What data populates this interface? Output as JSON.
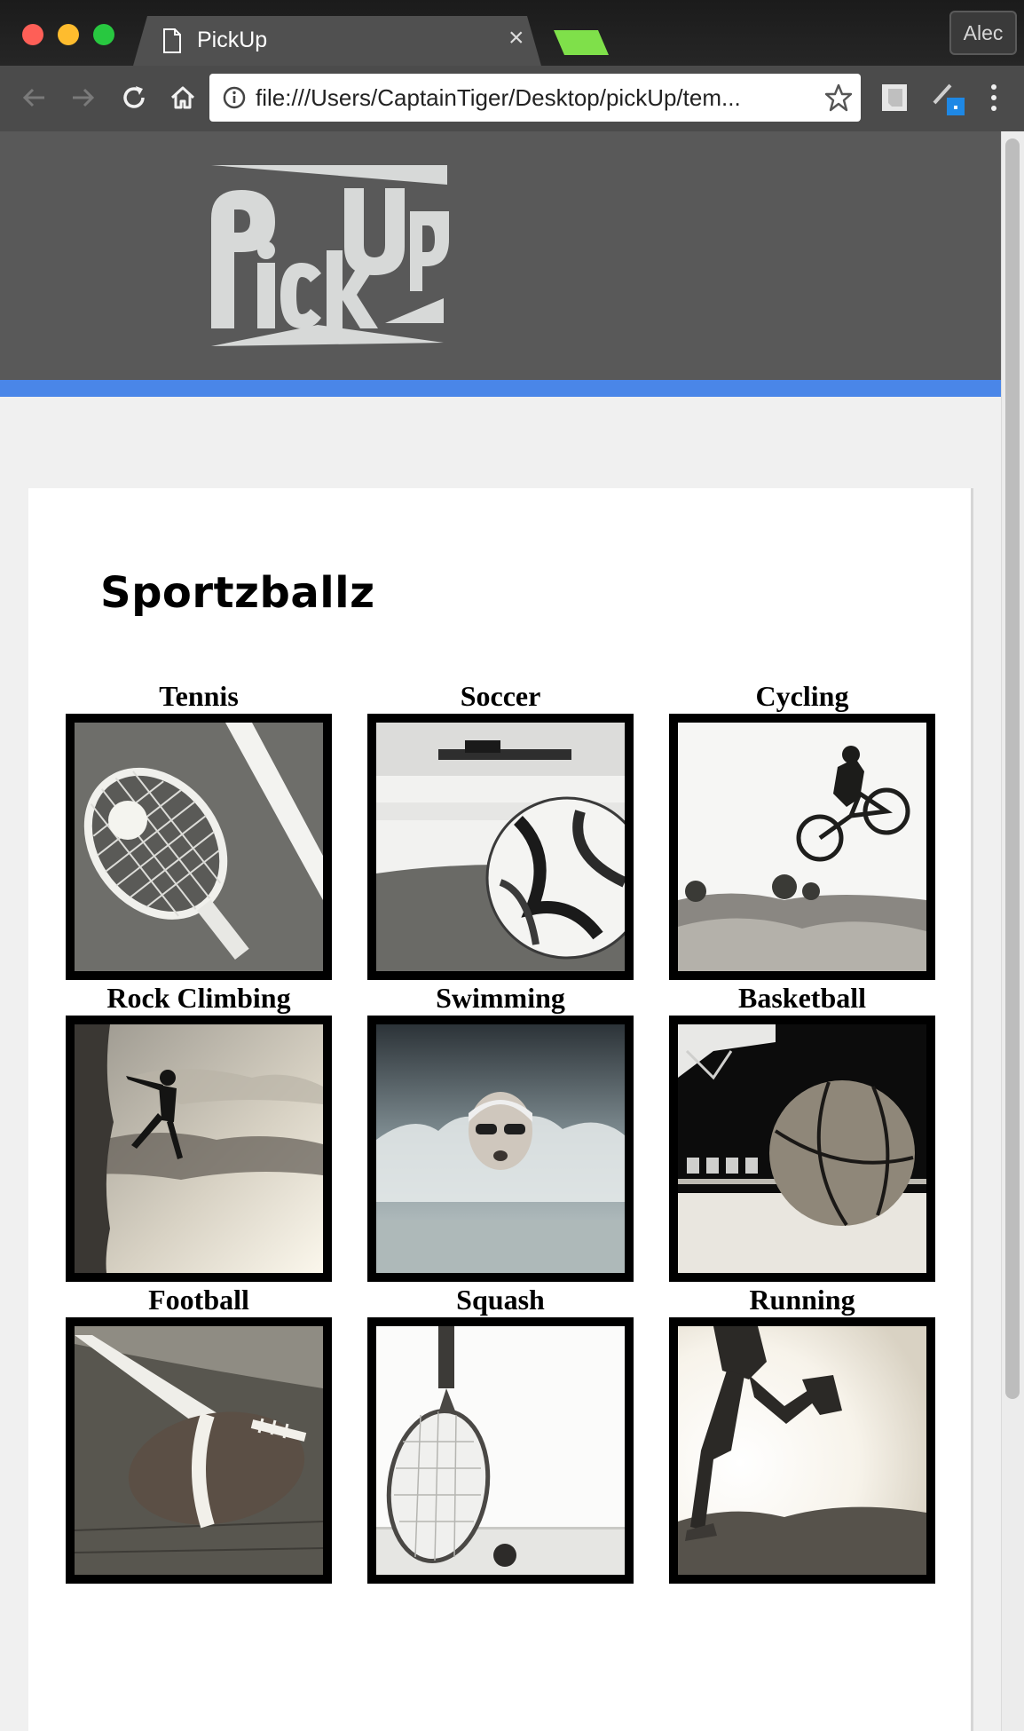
{
  "browser": {
    "tab_title": "PickUp",
    "tab_close": "×",
    "profile_name": "Alec",
    "url": "file:///Users/CaptainTiger/Desktop/pickUp/tem..."
  },
  "site": {
    "logo_text": "PickUp",
    "page_title": "Sportzballz",
    "accent_color": "#4a86e8",
    "header_color": "#595959",
    "sports": [
      {
        "label": "Tennis",
        "image": "tennis-photo"
      },
      {
        "label": "Soccer",
        "image": "soccer-photo"
      },
      {
        "label": "Cycling",
        "image": "cycling-photo"
      },
      {
        "label": "Rock Climbing",
        "image": "rock-climbing-photo"
      },
      {
        "label": "Swimming",
        "image": "swimming-photo"
      },
      {
        "label": "Basketball",
        "image": "basketball-photo"
      },
      {
        "label": "Football",
        "image": "football-photo"
      },
      {
        "label": "Squash",
        "image": "squash-photo"
      },
      {
        "label": "Running",
        "image": "running-photo"
      }
    ]
  }
}
